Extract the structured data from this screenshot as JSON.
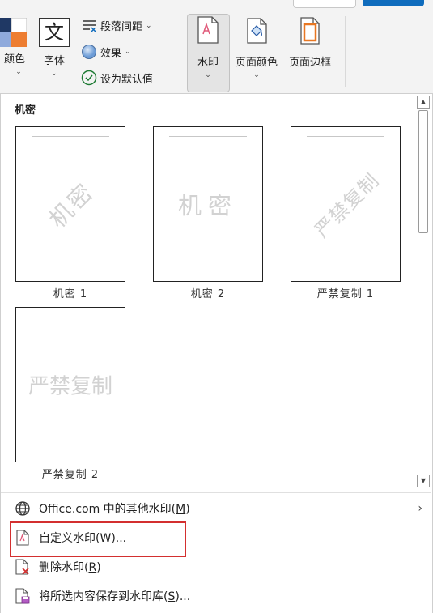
{
  "ribbon": {
    "theme_colors_label": "颜色",
    "fonts_label": "字体",
    "fonts_glyph": "文",
    "paragraph_spacing_label": "段落间距",
    "effects_label": "效果",
    "set_default_label": "设为默认值",
    "watermark_label": "水印",
    "page_color_label": "页面颜色",
    "page_borders_label": "页面边框",
    "theme_swatch_colors": [
      "#1f3864",
      "#c00000",
      "#ed7d31"
    ]
  },
  "gallery": {
    "section_title": "机密",
    "items": [
      {
        "caption": "机密 1",
        "watermark": "机密",
        "orientation": "diagonal"
      },
      {
        "caption": "机密 2",
        "watermark": "机密",
        "orientation": "horizontal"
      },
      {
        "caption": "严禁复制 1",
        "watermark": "严禁复制",
        "orientation": "diagonal"
      },
      {
        "caption": "严禁复制 2",
        "watermark": "严禁复制",
        "orientation": "horizontal"
      }
    ]
  },
  "menu": {
    "office_more": {
      "before": "Office.com 中的其他水印(",
      "key": "M",
      "after": ")"
    },
    "custom": {
      "before": "自定义水印(",
      "key": "W",
      "after": ")..."
    },
    "remove": {
      "before": "删除水印(",
      "key": "R",
      "after": ")"
    },
    "save_selection": {
      "before": "将所选内容保存到水印库(",
      "key": "S",
      "after": ")..."
    }
  },
  "colors": {
    "highlight": "#d32f2f",
    "accent": "#0f6cbd"
  }
}
